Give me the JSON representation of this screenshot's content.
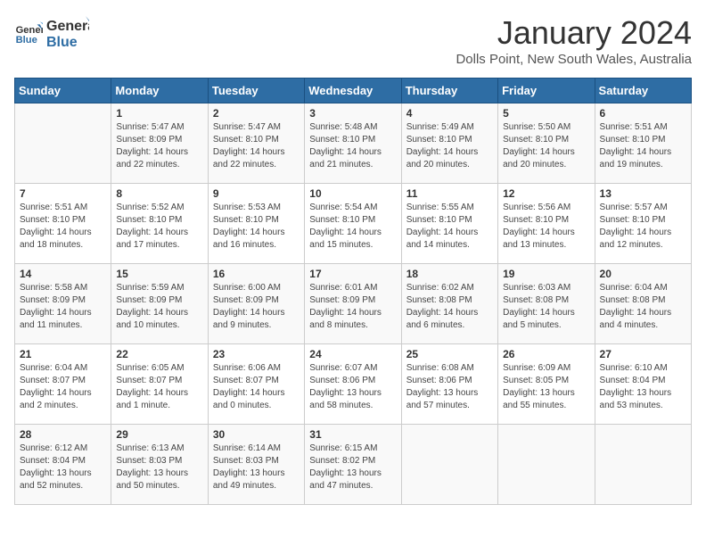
{
  "logo": {
    "line1": "General",
    "line2": "Blue"
  },
  "title": "January 2024",
  "location": "Dolls Point, New South Wales, Australia",
  "days_of_week": [
    "Sunday",
    "Monday",
    "Tuesday",
    "Wednesday",
    "Thursday",
    "Friday",
    "Saturday"
  ],
  "weeks": [
    [
      {
        "day": "",
        "content": ""
      },
      {
        "day": "1",
        "content": "Sunrise: 5:47 AM\nSunset: 8:09 PM\nDaylight: 14 hours\nand 22 minutes."
      },
      {
        "day": "2",
        "content": "Sunrise: 5:47 AM\nSunset: 8:10 PM\nDaylight: 14 hours\nand 22 minutes."
      },
      {
        "day": "3",
        "content": "Sunrise: 5:48 AM\nSunset: 8:10 PM\nDaylight: 14 hours\nand 21 minutes."
      },
      {
        "day": "4",
        "content": "Sunrise: 5:49 AM\nSunset: 8:10 PM\nDaylight: 14 hours\nand 20 minutes."
      },
      {
        "day": "5",
        "content": "Sunrise: 5:50 AM\nSunset: 8:10 PM\nDaylight: 14 hours\nand 20 minutes."
      },
      {
        "day": "6",
        "content": "Sunrise: 5:51 AM\nSunset: 8:10 PM\nDaylight: 14 hours\nand 19 minutes."
      }
    ],
    [
      {
        "day": "7",
        "content": "Sunrise: 5:51 AM\nSunset: 8:10 PM\nDaylight: 14 hours\nand 18 minutes."
      },
      {
        "day": "8",
        "content": "Sunrise: 5:52 AM\nSunset: 8:10 PM\nDaylight: 14 hours\nand 17 minutes."
      },
      {
        "day": "9",
        "content": "Sunrise: 5:53 AM\nSunset: 8:10 PM\nDaylight: 14 hours\nand 16 minutes."
      },
      {
        "day": "10",
        "content": "Sunrise: 5:54 AM\nSunset: 8:10 PM\nDaylight: 14 hours\nand 15 minutes."
      },
      {
        "day": "11",
        "content": "Sunrise: 5:55 AM\nSunset: 8:10 PM\nDaylight: 14 hours\nand 14 minutes."
      },
      {
        "day": "12",
        "content": "Sunrise: 5:56 AM\nSunset: 8:10 PM\nDaylight: 14 hours\nand 13 minutes."
      },
      {
        "day": "13",
        "content": "Sunrise: 5:57 AM\nSunset: 8:10 PM\nDaylight: 14 hours\nand 12 minutes."
      }
    ],
    [
      {
        "day": "14",
        "content": "Sunrise: 5:58 AM\nSunset: 8:09 PM\nDaylight: 14 hours\nand 11 minutes."
      },
      {
        "day": "15",
        "content": "Sunrise: 5:59 AM\nSunset: 8:09 PM\nDaylight: 14 hours\nand 10 minutes."
      },
      {
        "day": "16",
        "content": "Sunrise: 6:00 AM\nSunset: 8:09 PM\nDaylight: 14 hours\nand 9 minutes."
      },
      {
        "day": "17",
        "content": "Sunrise: 6:01 AM\nSunset: 8:09 PM\nDaylight: 14 hours\nand 8 minutes."
      },
      {
        "day": "18",
        "content": "Sunrise: 6:02 AM\nSunset: 8:08 PM\nDaylight: 14 hours\nand 6 minutes."
      },
      {
        "day": "19",
        "content": "Sunrise: 6:03 AM\nSunset: 8:08 PM\nDaylight: 14 hours\nand 5 minutes."
      },
      {
        "day": "20",
        "content": "Sunrise: 6:04 AM\nSunset: 8:08 PM\nDaylight: 14 hours\nand 4 minutes."
      }
    ],
    [
      {
        "day": "21",
        "content": "Sunrise: 6:04 AM\nSunset: 8:07 PM\nDaylight: 14 hours\nand 2 minutes."
      },
      {
        "day": "22",
        "content": "Sunrise: 6:05 AM\nSunset: 8:07 PM\nDaylight: 14 hours\nand 1 minute."
      },
      {
        "day": "23",
        "content": "Sunrise: 6:06 AM\nSunset: 8:07 PM\nDaylight: 14 hours\nand 0 minutes."
      },
      {
        "day": "24",
        "content": "Sunrise: 6:07 AM\nSunset: 8:06 PM\nDaylight: 13 hours\nand 58 minutes."
      },
      {
        "day": "25",
        "content": "Sunrise: 6:08 AM\nSunset: 8:06 PM\nDaylight: 13 hours\nand 57 minutes."
      },
      {
        "day": "26",
        "content": "Sunrise: 6:09 AM\nSunset: 8:05 PM\nDaylight: 13 hours\nand 55 minutes."
      },
      {
        "day": "27",
        "content": "Sunrise: 6:10 AM\nSunset: 8:04 PM\nDaylight: 13 hours\nand 53 minutes."
      }
    ],
    [
      {
        "day": "28",
        "content": "Sunrise: 6:12 AM\nSunset: 8:04 PM\nDaylight: 13 hours\nand 52 minutes."
      },
      {
        "day": "29",
        "content": "Sunrise: 6:13 AM\nSunset: 8:03 PM\nDaylight: 13 hours\nand 50 minutes."
      },
      {
        "day": "30",
        "content": "Sunrise: 6:14 AM\nSunset: 8:03 PM\nDaylight: 13 hours\nand 49 minutes."
      },
      {
        "day": "31",
        "content": "Sunrise: 6:15 AM\nSunset: 8:02 PM\nDaylight: 13 hours\nand 47 minutes."
      },
      {
        "day": "",
        "content": ""
      },
      {
        "day": "",
        "content": ""
      },
      {
        "day": "",
        "content": ""
      }
    ]
  ]
}
